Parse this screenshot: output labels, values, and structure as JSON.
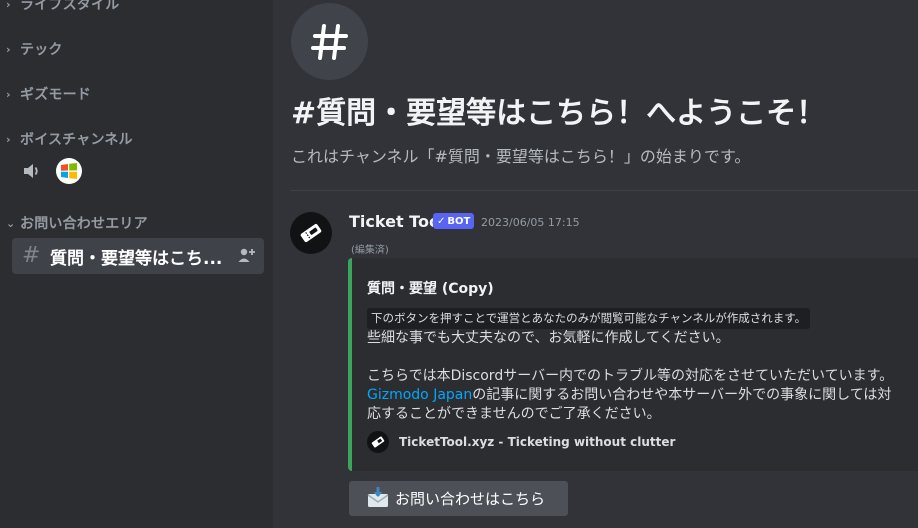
{
  "sidebar": {
    "categories": [
      {
        "label": "ライフスタイル"
      },
      {
        "label": "テック"
      },
      {
        "label": "ギズモード"
      },
      {
        "label": "ボイスチャンネル"
      },
      {
        "label": "お問い合わせエリア"
      }
    ],
    "active_channel": {
      "name": "質問・要望等はこち..."
    }
  },
  "main": {
    "welcome_title": "#質問・要望等はこちら！へようこそ！",
    "welcome_subtitle": "これはチャンネル「#質問・要望等はこちら！」の始まりです。",
    "message": {
      "author": "Ticket Tool",
      "bot_tag": "BOT",
      "timestamp": "2023/06/05 17:15",
      "edited": "(編集済)",
      "embed": {
        "title": "質問・要望 (Copy)",
        "code_line": "下のボタンを押すことで運営とあなたのみが閲覧可能なチャンネルが作成されます。",
        "line2": "些細な事でも大丈夫なので、お気軽に作成してください。",
        "line3": "こちらでは本Discordサーバー内でのトラブル等の対応をさせていただいています。",
        "link_text": "Gizmodo Japan",
        "line4_rest": "の記事に関するお問い合わせや本サーバー外での事象に関しては対",
        "line5": "応することができませんのでご了承ください。",
        "footer": "TicketTool.xyz - Ticketing without clutter",
        "accent_color": "#3ba55c"
      },
      "button_label": "お問い合わせはこちら"
    }
  }
}
